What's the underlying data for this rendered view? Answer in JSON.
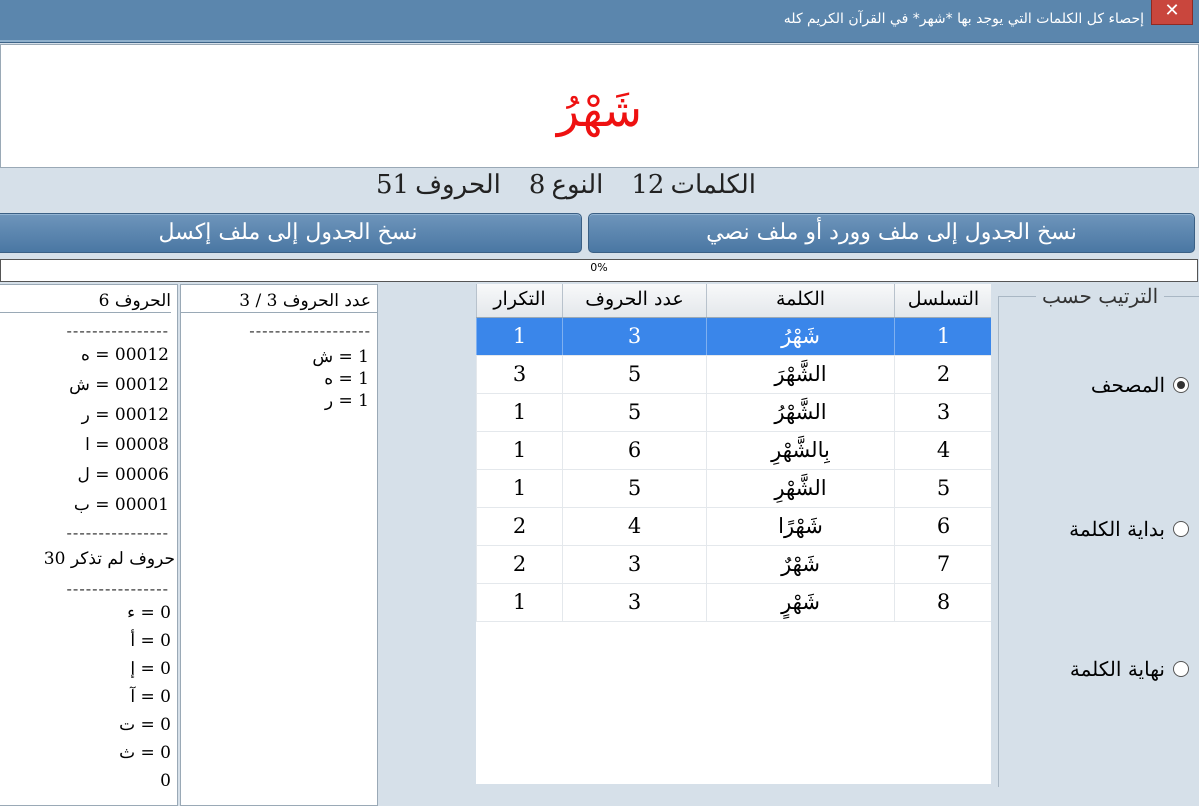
{
  "window": {
    "title": "إحصاء كل الكلمات التي يوجد بها *شهر*  في القرآن الكريم كله",
    "close_icon": "close-icon"
  },
  "word": "شَهْرُ",
  "stats": {
    "words_label": "الكلمات",
    "words_value": "12",
    "types_label": "النوع",
    "types_value": "8",
    "letters_label": "الحروف",
    "letters_value": "51"
  },
  "buttons": {
    "copy_word": "نسخ الجدول إلى ملف وورد أو ملف نصي",
    "copy_excel": "نسخ الجدول إلى ملف إكسل"
  },
  "progress": {
    "text": "0%",
    "value": 0
  },
  "table": {
    "headers": [
      "التسلسل",
      "الكلمة",
      "عدد الحروف",
      "التكرار"
    ],
    "rows": [
      {
        "seq": "1",
        "word": "شَهْرُ",
        "letters": "3",
        "count": "1",
        "selected": true
      },
      {
        "seq": "2",
        "word": "الشَّهْرَ",
        "letters": "5",
        "count": "3"
      },
      {
        "seq": "3",
        "word": "الشَّهْرُ",
        "letters": "5",
        "count": "1"
      },
      {
        "seq": "4",
        "word": "بِالشَّهْرِ",
        "letters": "6",
        "count": "1"
      },
      {
        "seq": "5",
        "word": "الشَّهْرِ",
        "letters": "5",
        "count": "1"
      },
      {
        "seq": "6",
        "word": "شَهْرًا",
        "letters": "4",
        "count": "2"
      },
      {
        "seq": "7",
        "word": "شَهْرٌ",
        "letters": "3",
        "count": "2"
      },
      {
        "seq": "8",
        "word": "شَهْرٍ",
        "letters": "3",
        "count": "1"
      }
    ]
  },
  "order_by": {
    "label": "الترتيب حسب",
    "options": [
      {
        "label": "المصحف",
        "selected": true
      },
      {
        "label": "بداية الكلمة",
        "selected": false
      },
      {
        "label": "نهاية الكلمة",
        "selected": false
      }
    ]
  },
  "counts_panel": {
    "header": "عدد الحروف 3 / 3",
    "dashes": "-------------------",
    "items": [
      "1 = ش",
      "1 = ه",
      "1 = ر"
    ]
  },
  "letters_panel": {
    "header": "الحروف 6",
    "dashes": "----------------",
    "items": [
      "00012 = ه",
      "00012 = ش",
      "00012 = ر",
      "00008 = ا",
      "00006 = ل",
      "00001 = ب"
    ],
    "dashes2": "----------------",
    "missing_label": "حروف لم تذكر 30",
    "dashes3": "----------------",
    "missing_items": [
      "0 = ء",
      "0 = أ",
      "0 = إ",
      "0 = آ",
      "0 = ت",
      "0 = ث",
      "0"
    ]
  }
}
